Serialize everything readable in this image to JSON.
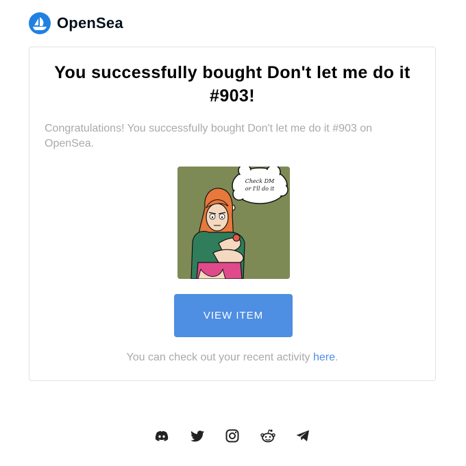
{
  "brand": {
    "name": "OpenSea",
    "color": "#2081e2",
    "icon": "opensea-logo-icon"
  },
  "card": {
    "title": "You successfully bought Don't let me do it #903!",
    "message": "Congratulations! You successfully bought Don't let me do it #903 on OpenSea.",
    "image": {
      "icon": "nft-artwork-image",
      "speech_text": "Check DM or I'll do it",
      "background": "#7d8a55"
    },
    "button_label": "VIEW ITEM",
    "button_color": "#4e8ee3",
    "activity_prefix": "You can check out your recent activity ",
    "activity_link": "here",
    "activity_suffix": "."
  },
  "footer": {
    "social": [
      {
        "icon": "discord-icon"
      },
      {
        "icon": "twitter-icon"
      },
      {
        "icon": "instagram-icon"
      },
      {
        "icon": "reddit-icon"
      },
      {
        "icon": "telegram-icon"
      }
    ]
  }
}
